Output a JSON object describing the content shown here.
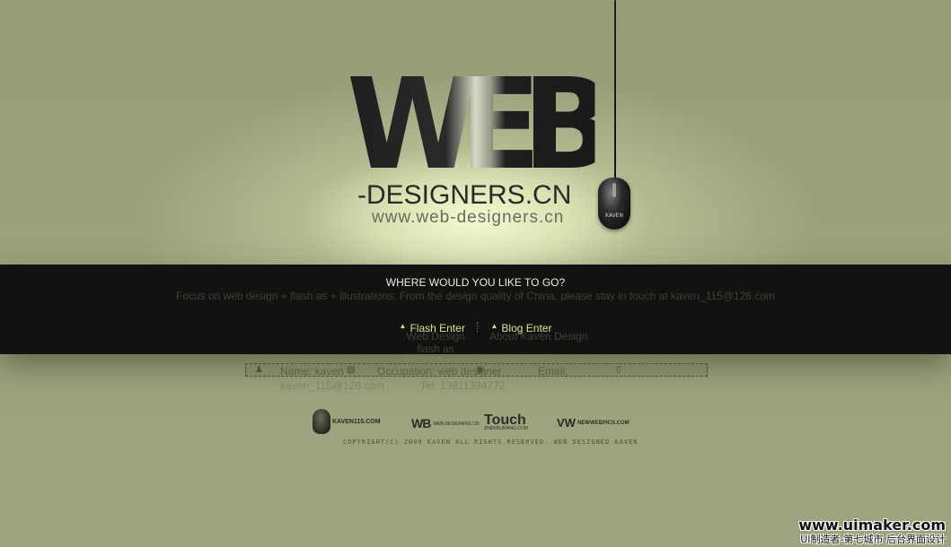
{
  "logo": {
    "mark": "WEB",
    "name": "-DESIGNERS.CN",
    "url": "www.web-designers.cn"
  },
  "mouse": {
    "label": "KAVEN"
  },
  "band": {
    "title": "WHERE WOULD YOU LIKE TO GO?",
    "description": "Focus on web design + flash as + illustrations. From the design quality of China, please stay in touch at kaven_115@126.com",
    "links": [
      {
        "label": "Flash Enter"
      },
      {
        "label": "Blog Enter"
      }
    ],
    "sub_links": {
      "web_design": "Web Design",
      "flash_as": "flash as",
      "about": "About Kaven Design"
    }
  },
  "contact": {
    "name": "Name: kaven",
    "occupation": "Occupation: web designer",
    "email_label": "Email:",
    "email": "kaven_115@126.com",
    "tel": "Tel: 13811334772"
  },
  "partners": {
    "kaven": "KAVEN115.COM",
    "wb": "WB",
    "wb_sub": "WEB-DESIGNERS.CN",
    "touch": "Touch",
    "touch_sub": "ZHENRUIPANG.COM",
    "vw": "VW",
    "vw_sub": "NEWWEBPICS.COM"
  },
  "footer": {
    "copyright": "COPYRIGHT(C) 2009 KAVEN ALL RIGHTS RESERVED.  WEB DESIGNED KAVEN"
  },
  "watermark": {
    "url": "www.uimaker.com",
    "cn": "UI制造者-第七城市 后台界面设计"
  },
  "colors": {
    "background": "#9aa17c",
    "band": "#121310",
    "accent": "#d7e67a"
  }
}
